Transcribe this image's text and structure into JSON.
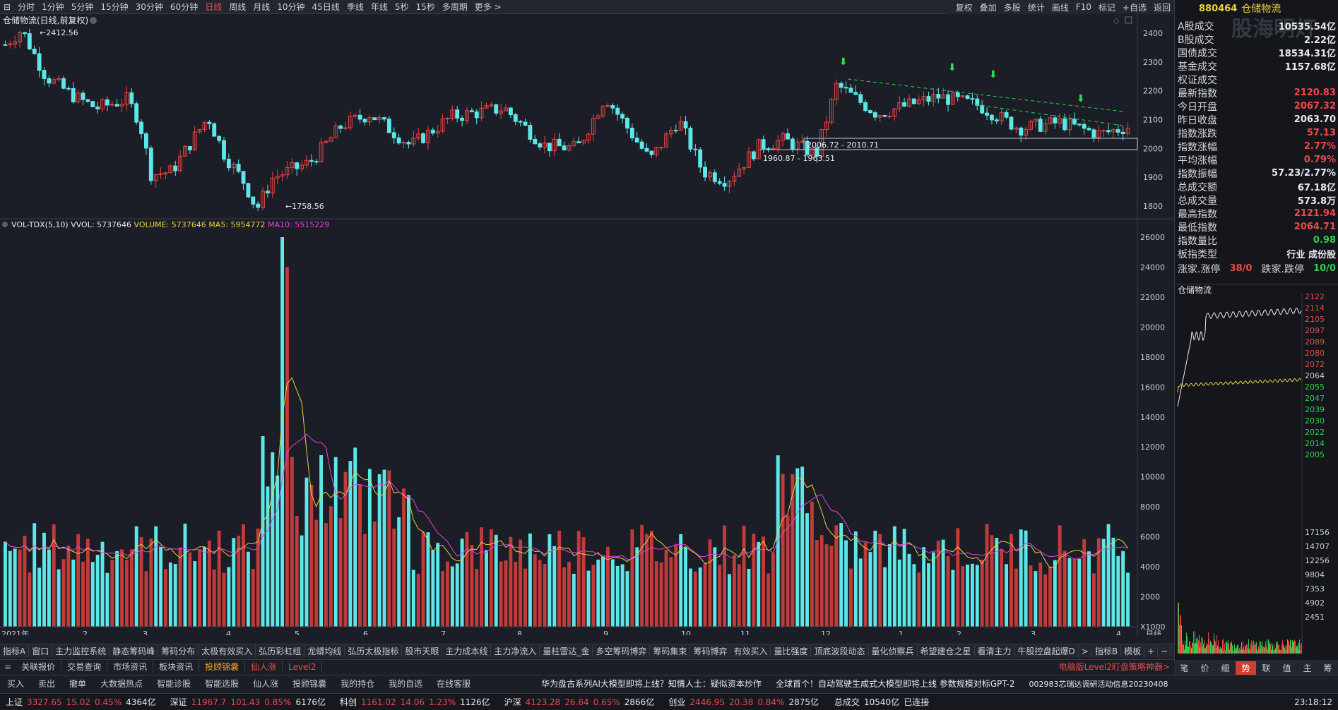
{
  "window": {
    "controls": "⊟"
  },
  "periods": [
    "分时",
    "1分钟",
    "5分钟",
    "15分钟",
    "30分钟",
    "60分钟",
    "日线",
    "周线",
    "月线",
    "10分钟",
    "45日线",
    "季线",
    "年线",
    "5秒",
    "15秒",
    "多周期",
    "更多 >"
  ],
  "active_period": "日线",
  "right_tools": [
    "复权",
    "叠加",
    "多股",
    "统计",
    "画线",
    "F10",
    "标记",
    "+自选",
    "返回"
  ],
  "chart_title": "仓储物流(日线,前复权)",
  "price_axis": [
    "2400",
    "2300",
    "2200",
    "2100",
    "2000",
    "1900",
    "1800"
  ],
  "annotations": {
    "high": "2412.56",
    "low": "1758.56",
    "box1": "2006.72 - 2010.71",
    "box2": "1960.87 - 1963.51"
  },
  "vol_header": {
    "name": "VOL-TDX(5,10)",
    "vvol": "VVOL: 5737646",
    "volume": "VOLUME: 5737646",
    "ma5": "MA5: 5954772",
    "ma10": "MA10: 5515229"
  },
  "vol_axis": [
    "26000",
    "24000",
    "22000",
    "20000",
    "18000",
    "16000",
    "14000",
    "12000",
    "10000",
    "8000",
    "6000",
    "4000",
    "2000",
    "X1000"
  ],
  "date_axis": [
    "2021年",
    "2",
    "3",
    "4",
    "5",
    "6",
    "7",
    "8",
    "9",
    "10",
    "11",
    "12",
    "1",
    "2",
    "3",
    "4"
  ],
  "date_axis_unit": "日线",
  "side": {
    "code": "880464",
    "name": "仓储物流",
    "watermark": "股海明灯",
    "rows": [
      {
        "k": "A股成交",
        "v": "10535.54亿",
        "c": "wht"
      },
      {
        "k": "B股成交",
        "v": "2.22亿",
        "c": "wht"
      },
      {
        "k": "国债成交",
        "v": "18534.31亿",
        "c": "wht"
      },
      {
        "k": "基金成交",
        "v": "1157.68亿",
        "c": "wht"
      },
      {
        "k": "权证成交",
        "v": "",
        "c": "wht"
      },
      {
        "k": "最新指数",
        "v": "2120.83",
        "c": "red"
      },
      {
        "k": "今日开盘",
        "v": "2067.32",
        "c": "red"
      },
      {
        "k": "昨日收盘",
        "v": "2063.70",
        "c": "wht"
      },
      {
        "k": "指数涨跌",
        "v": "57.13",
        "c": "red"
      },
      {
        "k": "指数涨幅",
        "v": "2.77%",
        "c": "red"
      },
      {
        "k": "平均涨幅",
        "v": "0.79%",
        "c": "red"
      },
      {
        "k": "指数振幅",
        "v": "57.23/2.77%",
        "c": "wht"
      },
      {
        "k": "总成交额",
        "v": "67.18亿",
        "c": "wht"
      },
      {
        "k": "总成交量",
        "v": "573.8万",
        "c": "wht"
      },
      {
        "k": "最高指数",
        "v": "2121.94",
        "c": "red"
      },
      {
        "k": "最低指数",
        "v": "2064.71",
        "c": "red"
      },
      {
        "k": "指数量比",
        "v": "0.98",
        "c": "grn"
      },
      {
        "k": "板指类型",
        "v": "行业 成份股",
        "c": "wht"
      }
    ],
    "updown": {
      "k1": "涨家.涨停",
      "v1": "38/0",
      "k2": "跌家.跌停",
      "v2": "10/0"
    },
    "mini_title": "仓储物流",
    "mini_price_axis": [
      "2122",
      "2114",
      "2105",
      "2097",
      "2089",
      "2080",
      "2072",
      "2064",
      "2055",
      "2047",
      "2039",
      "2030",
      "2022",
      "2014",
      "2005"
    ],
    "mini_vol_axis": [
      "17156",
      "14707",
      "12256",
      "9804",
      "7353",
      "4902",
      "2451"
    ],
    "tabs": [
      "笔",
      "价",
      "细",
      "势",
      "联",
      "值",
      "主",
      "筹"
    ],
    "active_tab": "势"
  },
  "indicators": [
    "指标A",
    "窗口",
    "主力监控系统",
    "静态筹码峰",
    "筹码分布",
    "太极有效买入",
    "弘历彩虹组",
    "龙蟒均线",
    "弘历太极指标",
    "股市天眼",
    "主力成本线",
    "主力净流入",
    "量柱雷达_金",
    "多空筹码博弈",
    "筹码集束",
    "筹码博弈",
    "有效买入",
    "量比强度",
    "顶底波段动态",
    "量化侦察兵",
    "希望建仓之星",
    "看清主力",
    "牛股控盘起爆D",
    ">",
    "指标B",
    "模板",
    "+",
    "−"
  ],
  "tabs": [
    "关联报价",
    "交易查询",
    "市场资讯",
    "板块资讯",
    "投顾锦囊",
    "仙人涨",
    "Level2"
  ],
  "tab_ad": "电脑版Level2盯盘策略神器>",
  "toolbar": [
    "买入",
    "卖出",
    "撤单",
    "大数据热点",
    "智能诊股",
    "智能选股",
    "仙人涨",
    "投顾锦囊",
    "我的持仓",
    "我的自选",
    "在线客服"
  ],
  "news1": "华为盘古系列AI大模型即将上线？知情人士：疑似资本炒作",
  "news2": "全球首个！自动驾驶生成式大模型即将上线 参数规模对标GPT-2",
  "news3": "002983芯瑞达调研活动信息20230408",
  "status": [
    {
      "n": "上证",
      "p": "3327.65",
      "c": "15.02",
      "r": "0.45%",
      "a": "4364亿"
    },
    {
      "n": "深证",
      "p": "11967.7",
      "c": "101.43",
      "r": "0.85%",
      "a": "6176亿"
    },
    {
      "n": "科创",
      "p": "1161.02",
      "c": "14.06",
      "r": "1.23%",
      "a": "1126亿"
    },
    {
      "n": "沪深",
      "p": "4123.28",
      "c": "26.64",
      "r": "0.65%",
      "a": "2866亿"
    },
    {
      "n": "创业",
      "p": "2446.95",
      "c": "20.38",
      "r": "0.84%",
      "a": "2875亿"
    }
  ],
  "total": {
    "k": "总成交",
    "v": "10540亿"
  },
  "conn": "已连接",
  "clock": "23:18:12"
}
